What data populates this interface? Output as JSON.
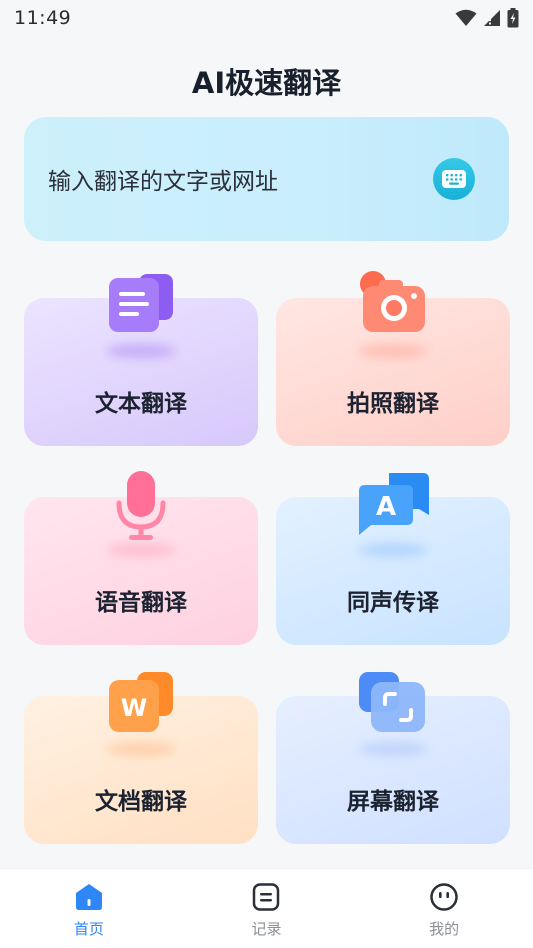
{
  "status_bar": {
    "time": "11:49"
  },
  "header": {
    "title": "AI极速翻译"
  },
  "input": {
    "placeholder": "输入翻译的文字或网址",
    "icon": "keyboard-icon"
  },
  "tiles": [
    {
      "label": "文本翻译",
      "icon": "text-document-icon"
    },
    {
      "label": "拍照翻译",
      "icon": "camera-icon"
    },
    {
      "label": "语音翻译",
      "icon": "microphone-icon"
    },
    {
      "label": "同声传译",
      "icon": "speech-bubble-a-icon"
    },
    {
      "label": "文档翻译",
      "icon": "word-document-icon"
    },
    {
      "label": "屏幕翻译",
      "icon": "screen-capture-icon"
    }
  ],
  "tabbar": {
    "items": [
      {
        "label": "首页",
        "icon": "home-icon",
        "active": true
      },
      {
        "label": "记录",
        "icon": "record-icon",
        "active": false
      },
      {
        "label": "我的",
        "icon": "profile-face-icon",
        "active": false
      }
    ]
  },
  "colors": {
    "accent": "#2f86f6",
    "keyboard_button": "#17b1d8",
    "title_text": "#18202d"
  }
}
